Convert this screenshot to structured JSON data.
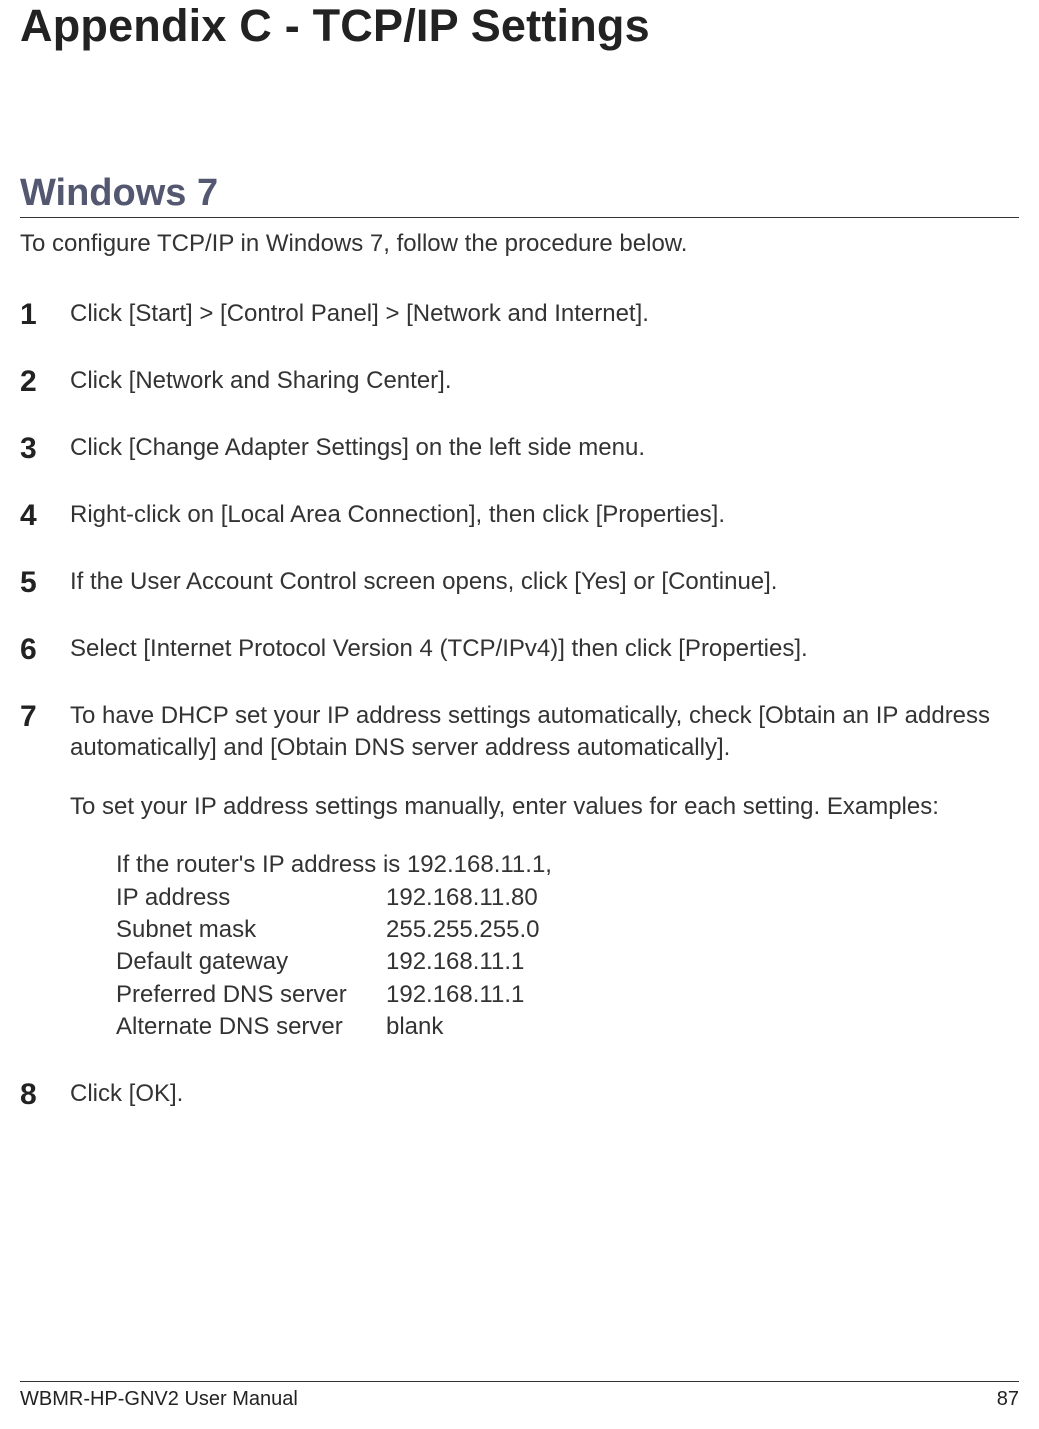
{
  "title": "Appendix C - TCP/IP Settings",
  "section": "Windows 7",
  "intro": "To configure TCP/IP in Windows 7, follow the procedure below.",
  "steps": {
    "s1": {
      "num": "1",
      "text": "Click [Start] > [Control Panel] > [Network and Internet]."
    },
    "s2": {
      "num": "2",
      "text": "Click [Network and Sharing Center]."
    },
    "s3": {
      "num": "3",
      "text": "Click [Change Adapter Settings] on the left side menu."
    },
    "s4": {
      "num": "4",
      "text": "Right-click on [Local Area Connection], then click [Properties]."
    },
    "s5": {
      "num": "5",
      "text": "If the User Account Control screen opens, click [Yes] or [Continue]."
    },
    "s6": {
      "num": "6",
      "text": "Select [Internet Protocol Version 4 (TCP/IPv4)] then click [Properties]."
    },
    "s7": {
      "num": "7",
      "p1": "To have DHCP set your IP address settings automatically, check [Obtain an IP address automatically] and [Obtain DNS server address automatically].",
      "p2": "To set your IP address settings manually, enter values for each setting.  Examples:",
      "example_intro": "If the router's IP address is 192.168.11.1,",
      "rows": {
        "r1": {
          "label": "IP address",
          "value": "192.168.11.80"
        },
        "r2": {
          "label": "Subnet mask",
          "value": "255.255.255.0"
        },
        "r3": {
          "label": "Default gateway",
          "value": "192.168.11.1"
        },
        "r4": {
          "label": "Preferred DNS server",
          "value": "192.168.11.1"
        },
        "r5": {
          "label": "Alternate DNS server",
          "value": "blank"
        }
      }
    },
    "s8": {
      "num": "8",
      "text": "Click [OK]."
    }
  },
  "footer": {
    "left": "WBMR-HP-GNV2 User Manual",
    "right": "87"
  }
}
